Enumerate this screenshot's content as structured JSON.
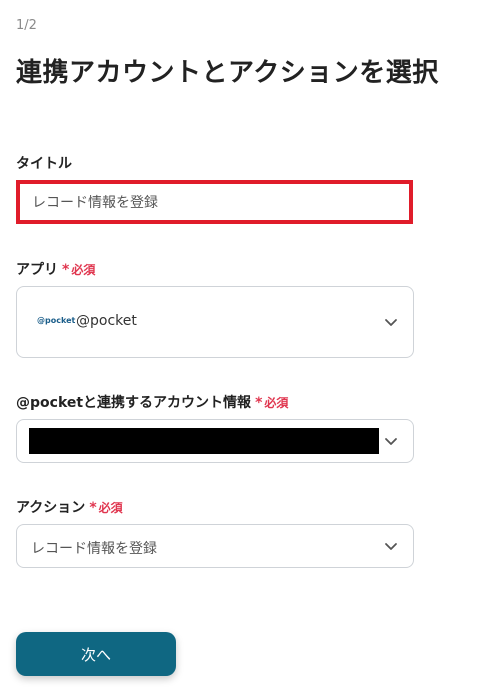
{
  "step": "1/2",
  "page_title": "連携アカウントとアクションを選択",
  "title_field": {
    "label": "タイトル",
    "value": "レコード情報を登録"
  },
  "app_field": {
    "label": "アプリ",
    "required": "必須",
    "logo_text": "@pocket",
    "value": "@pocket"
  },
  "account_field": {
    "label": "@pocketと連携するアカウント情報",
    "required": "必須"
  },
  "action_field": {
    "label": "アクション",
    "required": "必須",
    "value": "レコード情報を登録"
  },
  "next_button": "次へ",
  "colors": {
    "accent": "#0f6782",
    "required": "#e0364f",
    "highlight_border": "#e01c2a"
  }
}
